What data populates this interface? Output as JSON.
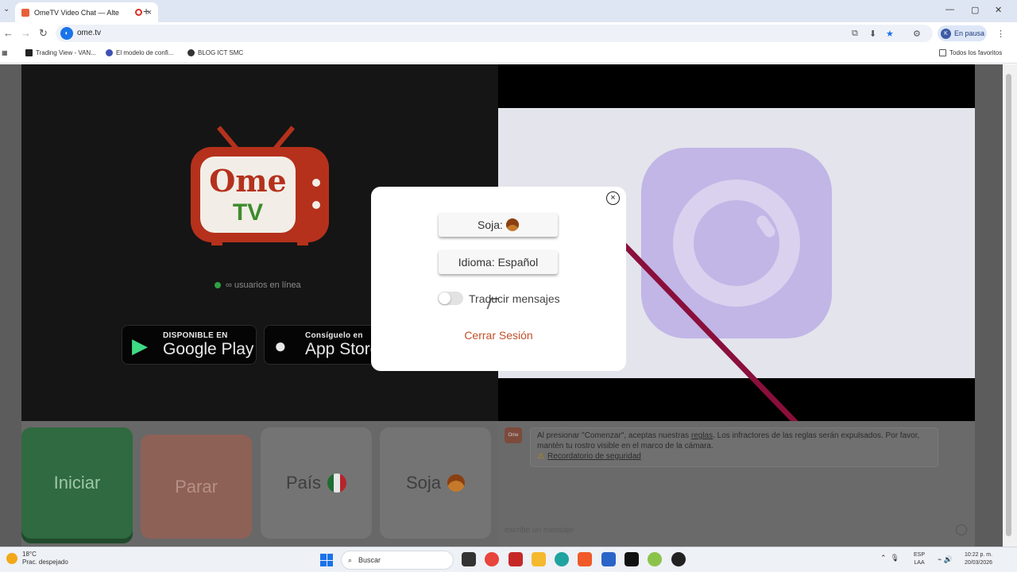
{
  "browser": {
    "tab_title": "OmeTV Video Chat — Alte",
    "tab_close": "×",
    "new_tab": "+",
    "url": "ome.tv",
    "profile_initial": "K",
    "profile_status": "En pausa",
    "window_controls": [
      "—",
      "▢",
      "✕"
    ],
    "bookmarks": [
      "Trading View - VAN...",
      "El modelo de confi...",
      "BLOG ICT SMC"
    ],
    "all_bookmarks": "Todos los favoritos"
  },
  "page": {
    "logo": {
      "ome": "Ome",
      "tv": "TV"
    },
    "online_status": "∞ usuarios en línea",
    "google_play": {
      "small": "DISPONIBLE EN",
      "big": "Google Play"
    },
    "app_store": {
      "small": "Consíguelo en",
      "big": "App Store"
    },
    "buttons": {
      "start": "Iniciar",
      "stop": "Parar",
      "country": "País",
      "gender": "Soja"
    },
    "chat": {
      "notice_prefix": "Al presionar \"Comenzar\", aceptas nuestras",
      "notice_link": "reglas",
      "notice_suffix": ". Los infractores de las reglas serán expulsados. Por favor, mantén tu rostro visible en el marco de la cámara.",
      "safety_link": "Recordatorio de seguridad",
      "input_placeholder": "escribe un mensaje"
    }
  },
  "modal": {
    "close": "×",
    "gender_button": "Soja:",
    "language_button": "Idioma: Español",
    "translate_label": "Traducir mensajes",
    "translate_on": false,
    "logout": "Cerrar Sesión"
  },
  "taskbar": {
    "weather_temp": "18°C",
    "weather_desc": "Prac. despejado",
    "search": "Buscar",
    "lang_1": "ESP",
    "lang_2": "LAA",
    "time": "10:22 p. m.",
    "date": "20/03/2026"
  },
  "colors": {
    "accent_logout": "#c2502a",
    "logo_red": "#b5311c",
    "logo_green": "#3d8c2c",
    "start_green": "#2f6a40",
    "strike": "#8a0f3b"
  }
}
